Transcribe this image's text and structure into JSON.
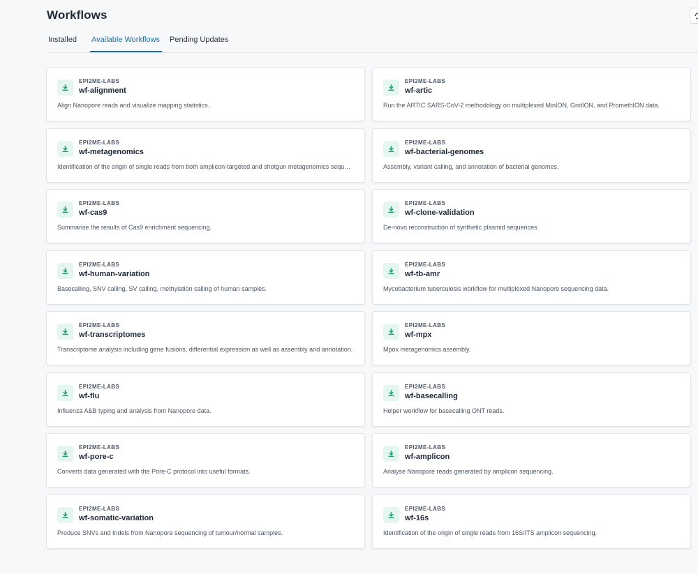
{
  "page": {
    "title": "Workflows"
  },
  "tabs": [
    {
      "label": "Installed",
      "active": false
    },
    {
      "label": "Available Workflows",
      "active": true
    },
    {
      "label": "Pending Updates",
      "active": false
    }
  ],
  "colors": {
    "accent": "#1f6f9f",
    "icon_bg": "#e5f5ef",
    "icon_fg": "#1a9b73"
  },
  "icons": {
    "card": "download-icon",
    "header": "refresh-icon"
  },
  "workflows": [
    {
      "org": "EPI2ME-LABS",
      "name": "wf-alignment",
      "description": "Align Nanopore reads and visualize mapping statistics."
    },
    {
      "org": "EPI2ME-LABS",
      "name": "wf-artic",
      "description": "Run the ARTIC SARS-CoV-2 methodology on multiplexed MinION, GridION, and PromethION data."
    },
    {
      "org": "EPI2ME-LABS",
      "name": "wf-metagenomics",
      "description": "Identification of the origin of single reads from both amplicon-targeted and shotgun metagenomics sequencing."
    },
    {
      "org": "EPI2ME-LABS",
      "name": "wf-bacterial-genomes",
      "description": "Assembly, variant calling, and annotation of bacterial genomes."
    },
    {
      "org": "EPI2ME-LABS",
      "name": "wf-cas9",
      "description": "Summarise the results of Cas9 enrichment sequencing."
    },
    {
      "org": "EPI2ME-LABS",
      "name": "wf-clone-validation",
      "description": "De-novo reconstruction of synthetic plasmid sequences."
    },
    {
      "org": "EPI2ME-LABS",
      "name": "wf-human-variation",
      "description": "Basecalling, SNV calling, SV calling, methylation calling of human samples."
    },
    {
      "org": "EPI2ME-LABS",
      "name": "wf-tb-amr",
      "description": "Mycobacterium tuberculosis workflow for multiplexed Nanopore sequencing data."
    },
    {
      "org": "EPI2ME-LABS",
      "name": "wf-transcriptomes",
      "description": "Transcriptome analysis including gene fusions, differential expression as well as assembly and annotation."
    },
    {
      "org": "EPI2ME-LABS",
      "name": "wf-mpx",
      "description": "Mpox metagenomics assembly."
    },
    {
      "org": "EPI2ME-LABS",
      "name": "wf-flu",
      "description": "Influenza A&B typing and analysis from Nanopore data."
    },
    {
      "org": "EPI2ME-LABS",
      "name": "wf-basecalling",
      "description": "Helper workflow for basecalling ONT reads."
    },
    {
      "org": "EPI2ME-LABS",
      "name": "wf-pore-c",
      "description": "Converts data generated with the Pore-C protocol into useful formats."
    },
    {
      "org": "EPI2ME-LABS",
      "name": "wf-amplicon",
      "description": "Analyse Nanopore reads generated by amplicon sequencing."
    },
    {
      "org": "EPI2ME-LABS",
      "name": "wf-somatic-variation",
      "description": "Produce SNVs and Indels from Nanopore sequencing of tumour/normal samples."
    },
    {
      "org": "EPI2ME-LABS",
      "name": "wf-16s",
      "description": "Identification of the origin of single reads from 16S/ITS amplicon sequencing."
    }
  ]
}
